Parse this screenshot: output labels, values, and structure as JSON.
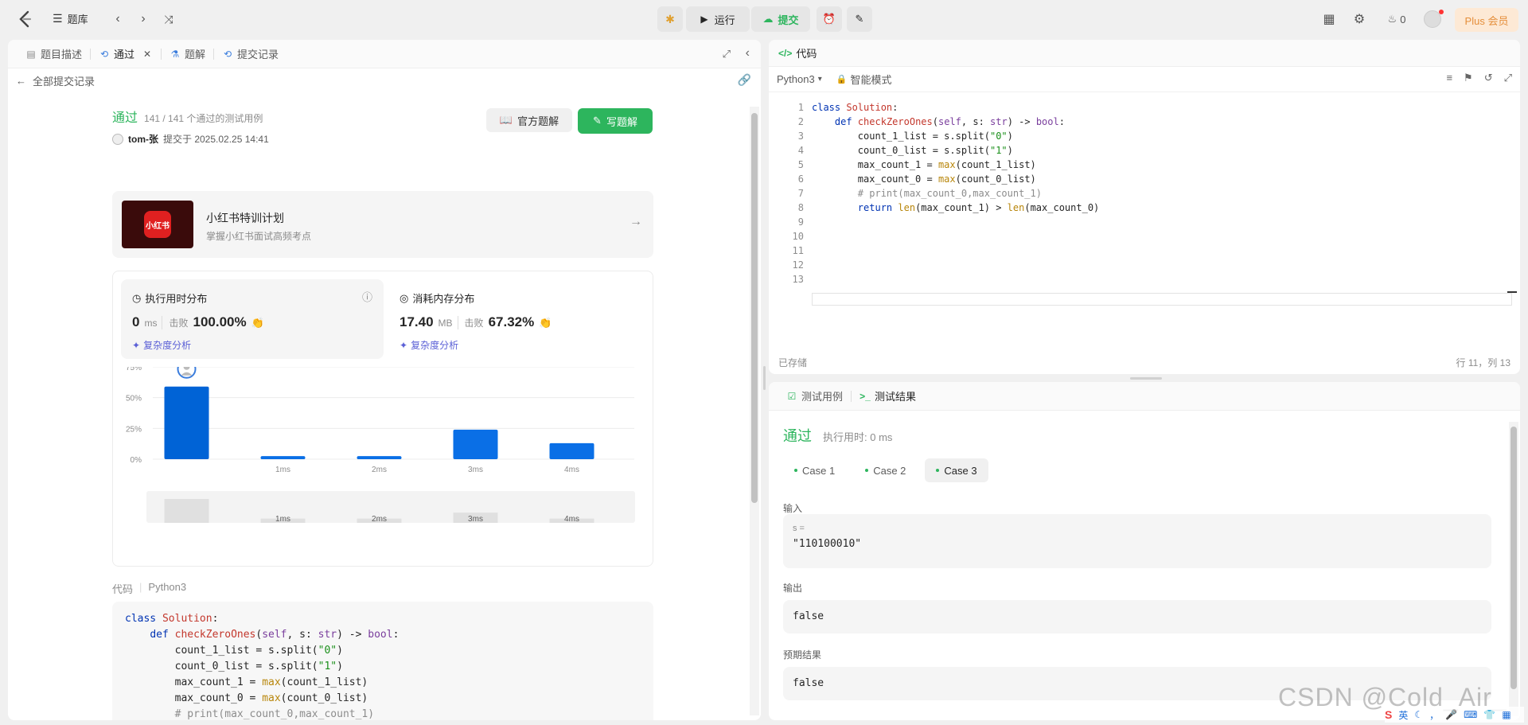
{
  "topbar": {
    "problem_bank": "题库",
    "run_label": "运行",
    "submit_label": "提交",
    "streak_count": "0",
    "plus_label": "Plus 会员"
  },
  "left_panel": {
    "tabs": [
      {
        "label": "题目描述"
      },
      {
        "label": "通过"
      },
      {
        "label": "题解"
      },
      {
        "label": "提交记录"
      }
    ],
    "back_label": "全部提交记录",
    "status": "通过",
    "cases_text": "141 / 141 个通过的测试用例",
    "author": "tom-张",
    "submitted_at": "提交于 2025.02.25 14:41",
    "official_solution_label": "官方题解",
    "write_solution_label": "写题解",
    "promo": {
      "badge": "小红书",
      "title": "小红书特训计划",
      "subtitle": "掌握小红书面试高频考点"
    },
    "runtime": {
      "title": "执行用时分布",
      "value": "0",
      "unit": "ms",
      "beat_label": "击败",
      "beat_pct": "100.00%",
      "complexity": "复杂度分析"
    },
    "memory": {
      "title": "消耗内存分布",
      "value": "17.40",
      "unit": "MB",
      "beat_label": "击败",
      "beat_pct": "67.32%",
      "complexity": "复杂度分析"
    },
    "code_label": "代码",
    "code_lang": "Python3"
  },
  "chart_data": {
    "type": "bar",
    "categories": [
      "",
      "1ms",
      "2ms",
      "3ms",
      "4ms"
    ],
    "values": [
      59,
      2.5,
      2.5,
      24,
      13
    ],
    "yticks": [
      "75%",
      "50%",
      "25%",
      "0%"
    ],
    "ylim": [
      0,
      75
    ],
    "grid": true,
    "highlight_index": 0,
    "overview_values": [
      28,
      5,
      5,
      12,
      5
    ],
    "overview_labels": [
      "",
      "1ms",
      "2ms",
      "3ms",
      "4ms"
    ],
    "bar_color": "#0a6fe6",
    "highlight_color": "#0063d6"
  },
  "code_lines": [
    "class Solution:",
    "    def checkZeroOnes(self, s: str) -> bool:",
    "        count_1_list = s.split(\"0\")",
    "        count_0_list = s.split(\"1\")",
    "        max_count_1 = max(count_1_list)",
    "        max_count_0 = max(count_0_list)",
    "        # print(max_count_0,max_count_1)",
    "        return len(max_count_1) > len(max_count_0)",
    "",
    "",
    "",
    "",
    ""
  ],
  "code_panel": {
    "title": "代码",
    "language": "Python3",
    "mode": "智能模式",
    "saved": "已存储",
    "cursor_pos": "行 11，列 13",
    "line_numbers": [
      "1",
      "2",
      "3",
      "4",
      "5",
      "6",
      "7",
      "8",
      "9",
      "10",
      "11",
      "12",
      "13"
    ]
  },
  "test_panel": {
    "tab_cases": "测试用例",
    "tab_results": "测试结果",
    "status": "通过",
    "time": "执行用时: 0 ms",
    "case_tabs": [
      "Case 1",
      "Case 2",
      "Case 3"
    ],
    "active_case": 2,
    "input_label": "输入",
    "input_var": "s =",
    "input_value": "\"110100010\"",
    "output_label": "输出",
    "output_value": "false",
    "expected_label": "预期结果",
    "expected_value": "false"
  },
  "watermark": "CSDN @Cold_Air_",
  "ime": {
    "lang": "英"
  },
  "colors": {
    "accent": "#2db55d",
    "bar": "#0a6fe6",
    "plus": "#e58e3a"
  }
}
